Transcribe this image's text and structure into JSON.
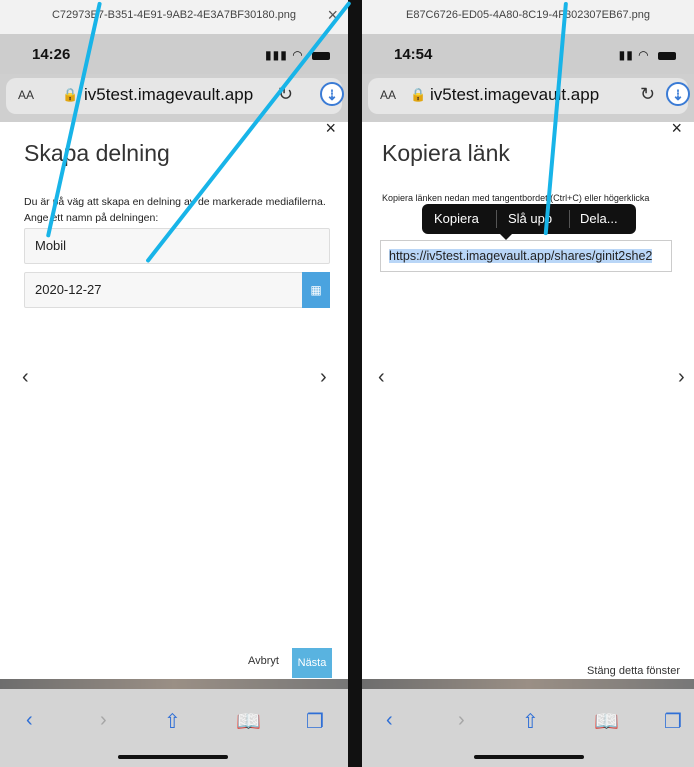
{
  "left": {
    "filename": "C72973E7-B351-4E91-9AB2-4E3A7BF30180.png",
    "status_time": "14:26",
    "url_aa": "AA",
    "url": "iv5test.imagevault.app",
    "modal_title": "Skapa delning",
    "modal_desc": "Du är på väg att skapa en delning av de markerade mediafilerna. Ange ett namn på delningen:",
    "name_value": "Mobil",
    "date_value": "2020-12-27",
    "cancel_label": "Avbryt",
    "next_label": "Nästa"
  },
  "right": {
    "filename": "E87C6726-ED05-4A80-8C19-4F302307EB67.png",
    "status_time": "14:54",
    "url_aa": "AA",
    "url": "iv5test.imagevault.app",
    "modal_title": "Kopiera länk",
    "modal_desc": "Kopiera länken nedan med tangentbordet (Ctrl+C) eller högerklicka",
    "link_value": "https://iv5test.imagevault.app/shares/ginit2she2",
    "popover": [
      "Kopiera",
      "Slå upp",
      "Dela..."
    ],
    "close_window_label": "Stäng detta fönster"
  },
  "icons": {
    "close": "×",
    "prev": "‹",
    "next": "›",
    "reload": "↻",
    "download": "⇣",
    "calendar": "▦",
    "lock": "🔒",
    "toolbar": [
      "‹",
      "›",
      "⇧",
      "📖",
      "❐"
    ]
  },
  "colors": {
    "accent": "#18b4e8",
    "safari_blue": "#2f6fd6",
    "primary_button": "#59b3e0"
  }
}
